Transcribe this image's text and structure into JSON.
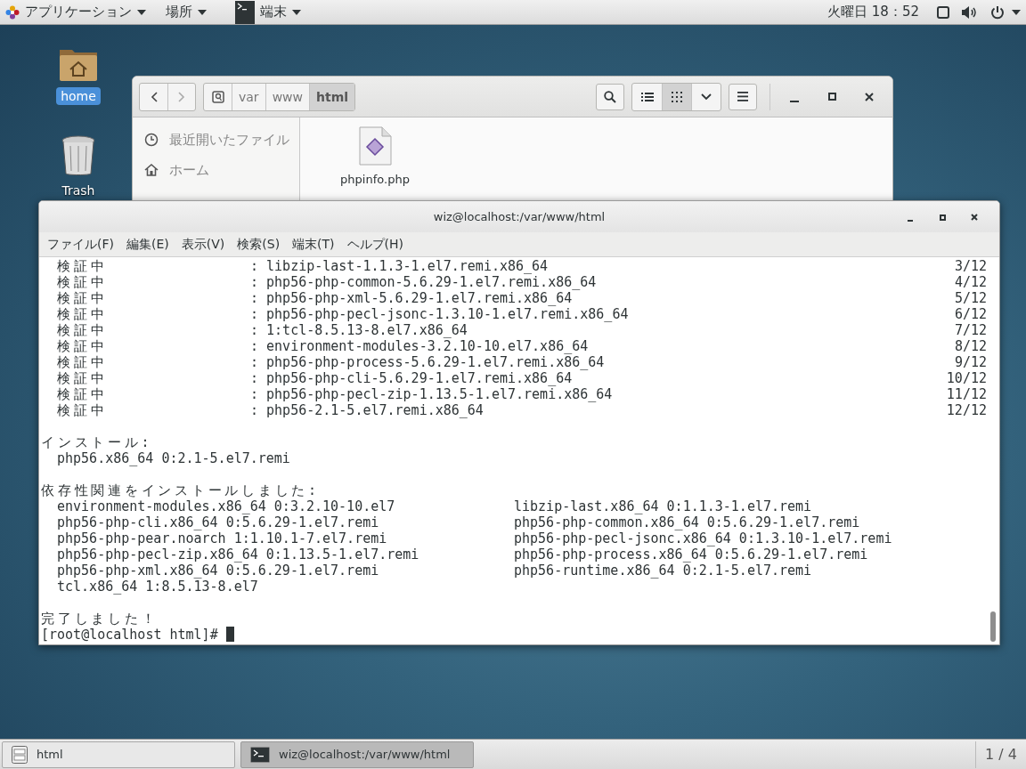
{
  "top_bar": {
    "menus": [
      {
        "label": "アプリケーション",
        "kind": "apps"
      },
      {
        "label": "場所",
        "kind": "plain"
      },
      {
        "label": "端末",
        "kind": "app"
      }
    ],
    "clock": "火曜日 18：52"
  },
  "desktop_icons": [
    {
      "label": "home",
      "kind": "home",
      "selected": true
    },
    {
      "label": "Trash",
      "kind": "trash",
      "selected": false
    }
  ],
  "files_window": {
    "path": [
      {
        "label": "var",
        "selected": false
      },
      {
        "label": "www",
        "selected": false
      },
      {
        "label": "html",
        "selected": true
      }
    ],
    "views": [
      {
        "kind": "list",
        "selected": false
      },
      {
        "kind": "grid",
        "selected": true
      }
    ],
    "sidebar": [
      {
        "label": "最近開いたファイル",
        "kind": "recent"
      },
      {
        "label": "ホーム",
        "kind": "home"
      }
    ],
    "files": [
      {
        "name": "phpinfo.php"
      }
    ]
  },
  "terminal": {
    "title": "wiz@localhost:/var/www/html",
    "menu": [
      "ファイル(F)",
      "編集(E)",
      "表示(V)",
      "検索(S)",
      "端末(T)",
      "ヘルプ(H)"
    ],
    "verify_rows": [
      {
        "status": "検証中",
        "package": ": libzip-last-1.1.3-1.el7.remi.x86_64",
        "count": "3/12"
      },
      {
        "status": "検証中",
        "package": ": php56-php-common-5.6.29-1.el7.remi.x86_64",
        "count": "4/12"
      },
      {
        "status": "検証中",
        "package": ": php56-php-xml-5.6.29-1.el7.remi.x86_64",
        "count": "5/12"
      },
      {
        "status": "検証中",
        "package": ": php56-php-pecl-jsonc-1.3.10-1.el7.remi.x86_64",
        "count": "6/12"
      },
      {
        "status": "検証中",
        "package": ": 1:tcl-8.5.13-8.el7.x86_64",
        "count": "7/12"
      },
      {
        "status": "検証中",
        "package": ": environment-modules-3.2.10-10.el7.x86_64",
        "count": "8/12"
      },
      {
        "status": "検証中",
        "package": ": php56-php-process-5.6.29-1.el7.remi.x86_64",
        "count": "9/12"
      },
      {
        "status": "検証中",
        "package": ": php56-php-cli-5.6.29-1.el7.remi.x86_64",
        "count": "10/12"
      },
      {
        "status": "検証中",
        "package": ": php56-php-pecl-zip-1.13.5-1.el7.remi.x86_64",
        "count": "11/12"
      },
      {
        "status": "検証中",
        "package": ": php56-2.1-5.el7.remi.x86_64",
        "count": "12/12"
      }
    ],
    "install_heading": "インストール:",
    "installed": [
      "php56.x86_64 0:2.1-5.el7.remi"
    ],
    "deps_heading": "依存性関連をインストールしました:",
    "deps": [
      "environment-modules.x86_64 0:3.2.10-10.el7",
      "libzip-last.x86_64 0:1.1.3-1.el7.remi",
      "php56-php-cli.x86_64 0:5.6.29-1.el7.remi",
      "php56-php-common.x86_64 0:5.6.29-1.el7.remi",
      "php56-php-pear.noarch 1:1.10.1-7.el7.remi",
      "php56-php-pecl-jsonc.x86_64 0:1.3.10-1.el7.remi",
      "php56-php-pecl-zip.x86_64 0:1.13.5-1.el7.remi",
      "php56-php-process.x86_64 0:5.6.29-1.el7.remi",
      "php56-php-xml.x86_64 0:5.6.29-1.el7.remi",
      "php56-runtime.x86_64 0:2.1-5.el7.remi",
      "tcl.x86_64 1:8.5.13-8.el7"
    ],
    "complete": "完了しました！",
    "prompt": "[root@localhost html]#"
  },
  "taskbar": {
    "tasks": [
      {
        "label": "html",
        "kind": "files",
        "selected": false
      },
      {
        "label": "wiz@localhost:/var/www/html",
        "kind": "terminal",
        "selected": true
      }
    ],
    "workspace": "1 / 4"
  }
}
